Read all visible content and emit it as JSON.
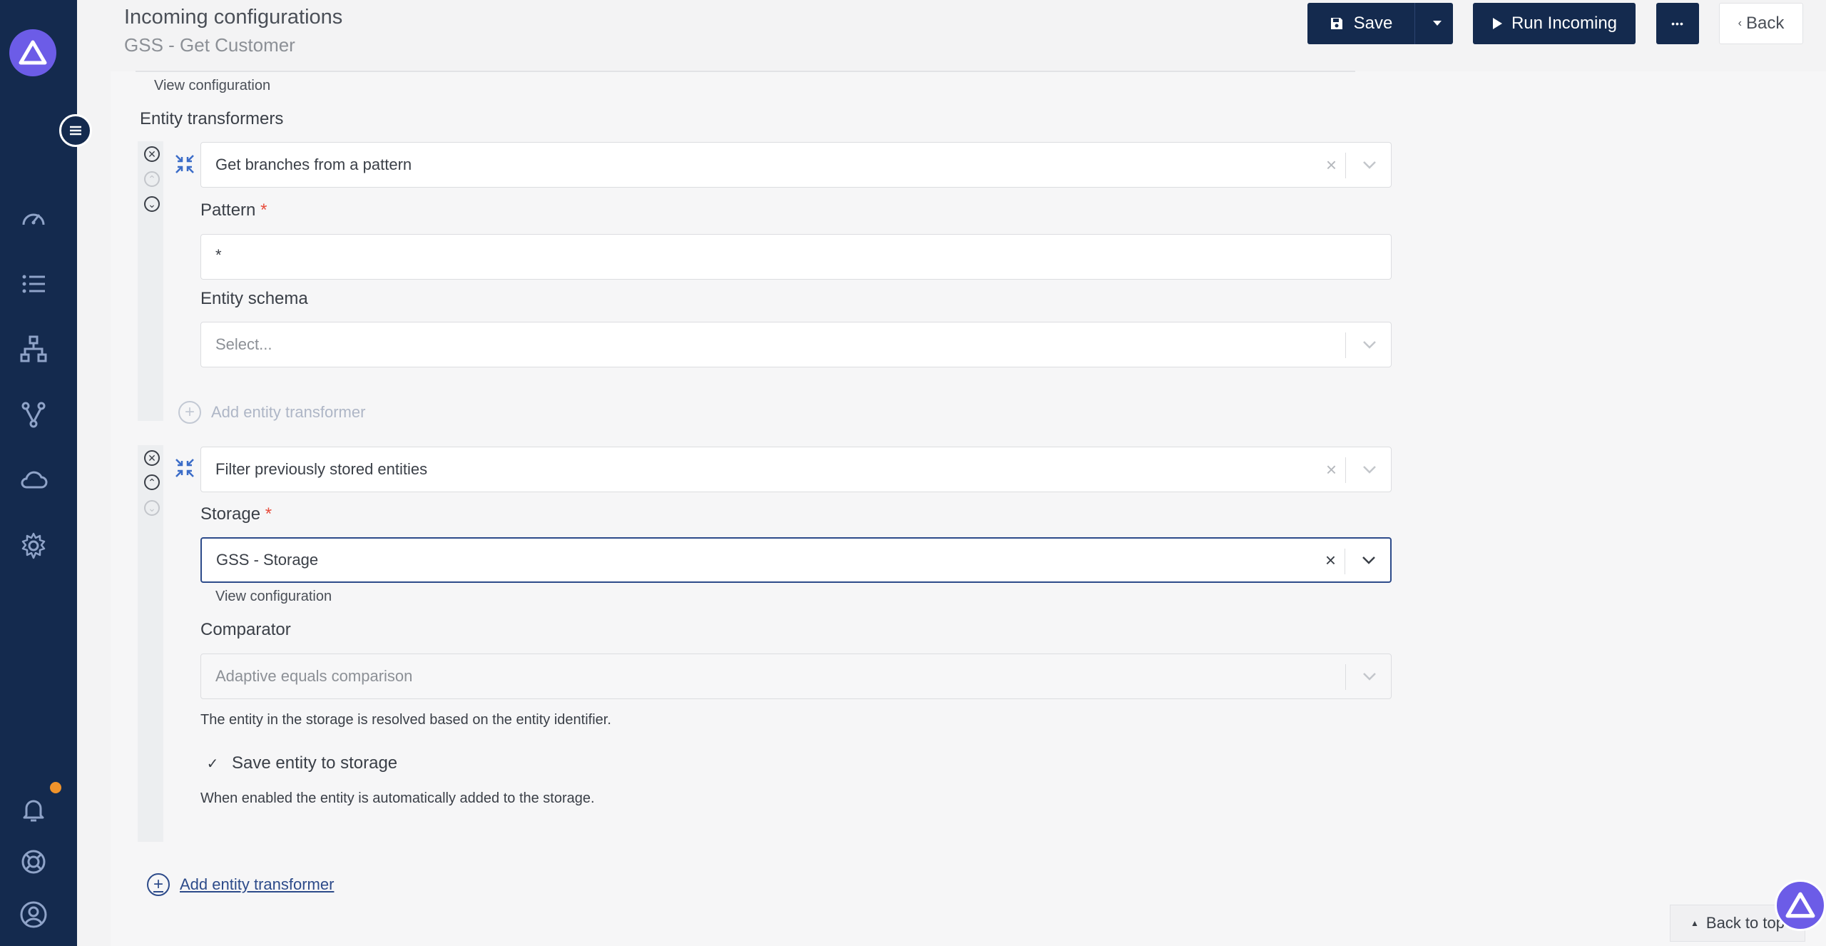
{
  "header": {
    "title": "Incoming configurations",
    "subtitle": "GSS - Get Customer",
    "save_label": "Save",
    "run_label": "Run Incoming",
    "more_label": "•••",
    "back_label": "Back"
  },
  "content": {
    "top_view_configuration": "View configuration",
    "section_label": "Entity transformers",
    "transformer1": {
      "title": "Get branches from a pattern",
      "pattern_label": "Pattern",
      "pattern_required": "*",
      "pattern_value": "*",
      "schema_label": "Entity schema",
      "schema_placeholder": "Select..."
    },
    "add_transformer_inner": "Add entity transformer",
    "transformer2": {
      "title": "Filter previously stored entities",
      "storage_label": "Storage",
      "storage_required": "*",
      "storage_value": "GSS - Storage",
      "view_configuration": "View configuration",
      "comparator_label": "Comparator",
      "comparator_value": "Adaptive equals comparison",
      "comparator_help": "The entity in the storage is resolved based on the entity identifier.",
      "save_checkbox_label": "Save entity to storage",
      "save_checkbox_help": "When enabled the entity is automatically added to the storage."
    },
    "add_transformer_outer": "Add entity transformer",
    "back_to_top": "Back to top"
  }
}
